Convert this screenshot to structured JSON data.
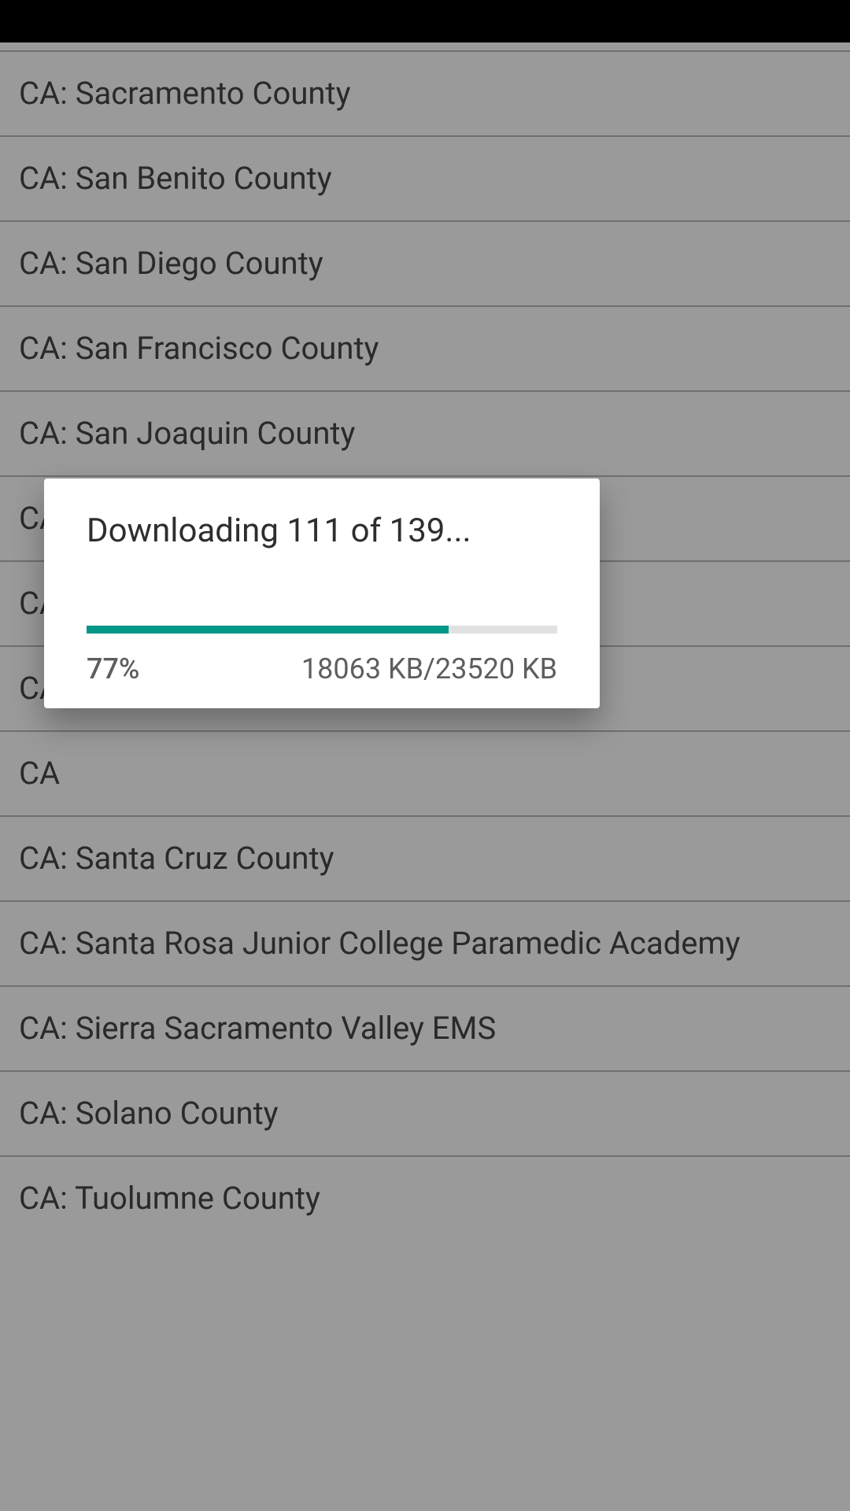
{
  "list": {
    "items": [
      "CA: Sacramento County",
      "CA: San Benito County",
      "CA: San Diego County",
      "CA: San Francisco County",
      "CA: San Joaquin County",
      "CA: San Luis Obispo County",
      "CA",
      "CA",
      "CA",
      "CA: Santa Cruz County",
      "CA: Santa Rosa Junior College Paramedic Academy",
      "CA: Sierra Sacramento Valley EMS",
      "CA: Solano County",
      "CA: Tuolumne County"
    ]
  },
  "dialog": {
    "title": "Downloading 111 of 139...",
    "percent_label": "77%",
    "percent_value": 77,
    "size_label": "18063 KB/23520 KB"
  },
  "colors": {
    "accent": "#009688"
  }
}
